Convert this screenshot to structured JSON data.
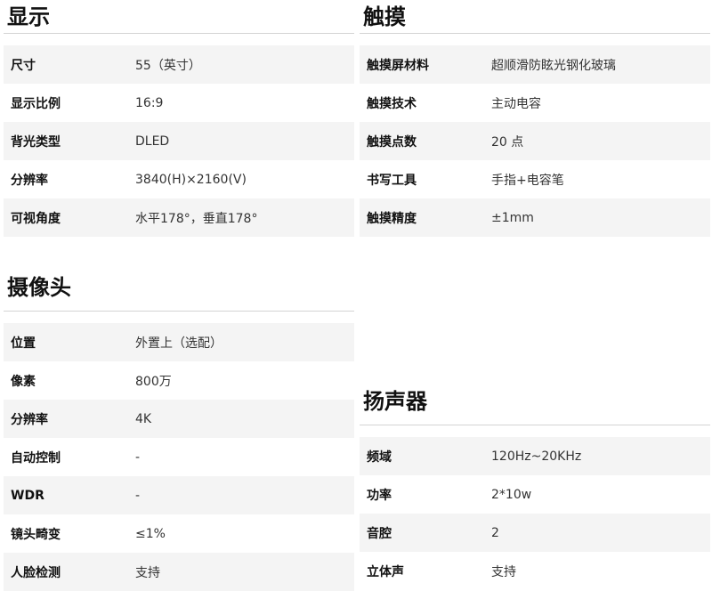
{
  "display": {
    "title": "显示",
    "rows": [
      {
        "k": "尺寸",
        "v": "55（英寸）"
      },
      {
        "k": "显示比例",
        "v": "16:9"
      },
      {
        "k": "背光类型",
        "v": "DLED"
      },
      {
        "k": "分辨率",
        "v": "3840(H)×2160(V)"
      },
      {
        "k": "可视角度",
        "v": "水平178°，垂直178°"
      }
    ]
  },
  "touch": {
    "title": "触摸",
    "rows": [
      {
        "k": "触摸屏材料",
        "v": "超顺滑防眩光钢化玻璃"
      },
      {
        "k": "触摸技术",
        "v": "主动电容"
      },
      {
        "k": "触摸点数",
        "v": "20 点"
      },
      {
        "k": "书写工具",
        "v": "手指+电容笔"
      },
      {
        "k": "触摸精度",
        "v": "±1mm"
      }
    ]
  },
  "camera": {
    "title": "摄像头",
    "rows": [
      {
        "k": "位置",
        "v": "外置上（选配）"
      },
      {
        "k": "像素",
        "v": "800万"
      },
      {
        "k": "分辨率",
        "v": "4K"
      },
      {
        "k": "自动控制",
        "v": "-"
      },
      {
        "k": "WDR",
        "v": "-"
      },
      {
        "k": "镜头畸变",
        "v": "≤1%"
      },
      {
        "k": "人脸检测",
        "v": "支持"
      }
    ]
  },
  "speaker": {
    "title": "扬声器",
    "rows": [
      {
        "k": "频域",
        "v": "120Hz~20KHz"
      },
      {
        "k": "功率",
        "v": "2*10w"
      },
      {
        "k": "音腔",
        "v": "2"
      },
      {
        "k": "立体声",
        "v": "支持"
      }
    ]
  }
}
